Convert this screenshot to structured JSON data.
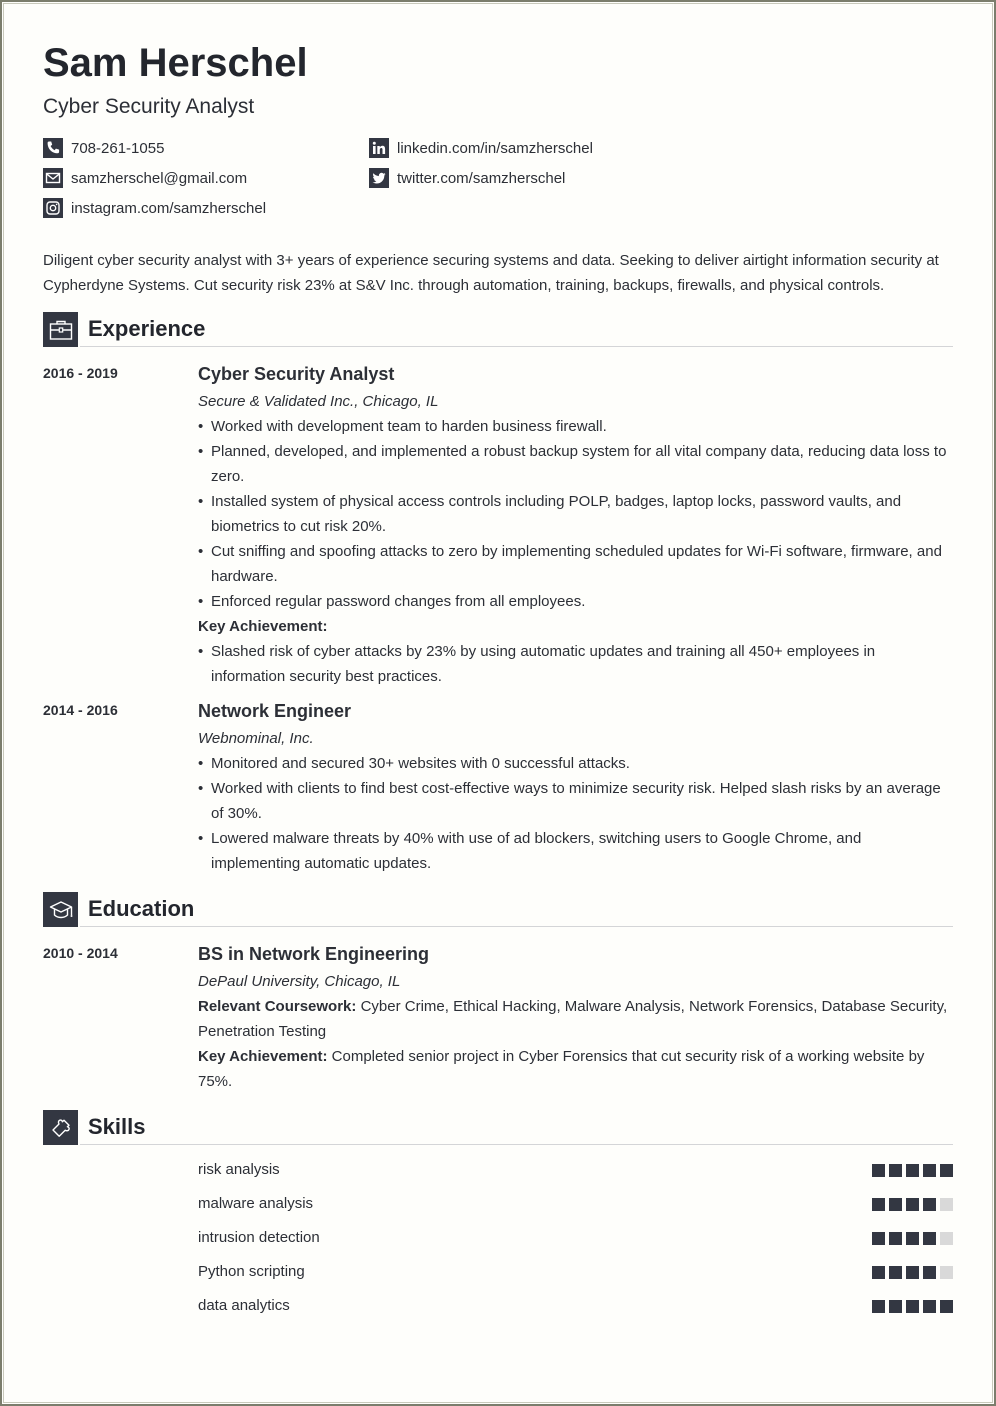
{
  "header": {
    "name": "Sam Herschel",
    "title": "Cyber Security Analyst"
  },
  "contacts": [
    {
      "icon": "phone-icon",
      "text": "708-261-1055"
    },
    {
      "icon": "email-icon",
      "text": "samzherschel@gmail.com"
    },
    {
      "icon": "instagram-icon",
      "text": "instagram.com/samzherschel"
    },
    {
      "icon": "linkedin-icon",
      "text": "linkedin.com/in/samzherschel"
    },
    {
      "icon": "twitter-icon",
      "text": "twitter.com/samzherschel"
    }
  ],
  "summary": "Diligent cyber security analyst with 3+ years of experience securing systems and data. Seeking to deliver airtight information security at Cypherdyne Systems. Cut security risk 23% at S&V Inc. through automation, training, backups, firewalls, and physical controls.",
  "experience": {
    "heading": "Experience",
    "icon": "briefcase-icon",
    "jobs": [
      {
        "dates": "2016 - 2019",
        "role": "Cyber Security Analyst",
        "org": "Secure & Validated Inc., Chicago, IL",
        "bullets": [
          "Worked with development team to harden business firewall.",
          "Planned, developed, and implemented a robust backup system for all vital company data, reducing data loss to zero.",
          "Installed system of physical access controls including POLP, badges, laptop locks, password vaults, and biometrics to cut risk 20%.",
          "Cut sniffing and spoofing attacks to zero by implementing scheduled updates for Wi-Fi software, firmware, and hardware.",
          "Enforced regular password changes from all employees."
        ],
        "key_label": "Key Achievement:",
        "key_bullets": [
          "Slashed risk of cyber attacks by 23% by using automatic updates and training all 450+ employees in information security best practices."
        ]
      },
      {
        "dates": "2014 - 2016",
        "role": "Network Engineer",
        "org": "Webnominal, Inc.",
        "bullets": [
          "Monitored and secured 30+ websites with 0 successful attacks.",
          "Worked with clients to find best cost-effective ways to minimize security risk. Helped slash risks by an average of 30%.",
          "Lowered malware threats by 40% with use of ad blockers, switching users to Google Chrome, and implementing automatic updates."
        ]
      }
    ]
  },
  "education": {
    "heading": "Education",
    "icon": "graduation-cap-icon",
    "items": [
      {
        "dates": "2010 - 2014",
        "degree": "BS in Network Engineering",
        "school": "DePaul University, Chicago, IL",
        "coursework_label": "Relevant Coursework:",
        "coursework": "Cyber Crime, Ethical Hacking, Malware Analysis, Network Forensics, Database Security, Penetration Testing",
        "achievement_label": "Key Achievement:",
        "achievement": "Completed senior project in Cyber Forensics that cut security risk of a working website by 75%."
      }
    ]
  },
  "skills": {
    "heading": "Skills",
    "icon": "puzzle-icon",
    "max_level": 5,
    "items": [
      {
        "name": "risk analysis",
        "level": 5
      },
      {
        "name": "malware analysis",
        "level": 4
      },
      {
        "name": "intrusion detection",
        "level": 4
      },
      {
        "name": "Python scripting",
        "level": 4
      },
      {
        "name": "data analytics",
        "level": 5
      }
    ]
  }
}
